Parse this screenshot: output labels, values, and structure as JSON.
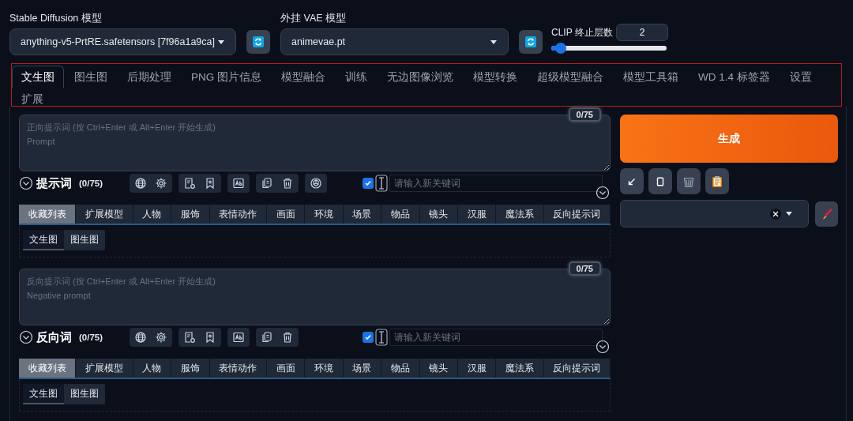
{
  "model_selectors": [
    {
      "label": "Stable Diffusion 模型",
      "value": "anything-v5-PrtRE.safetensors [7f96a1a9ca]"
    },
    {
      "label": "外挂 VAE 模型",
      "value": "animevae.pt"
    }
  ],
  "clip_skip": {
    "label": "CLIP 终止层数",
    "value": "2",
    "level": 0.08
  },
  "tabs": [
    {
      "label": "文生图",
      "selected": true
    },
    {
      "label": "图生图",
      "selected": false
    },
    {
      "label": "后期处理",
      "selected": false
    },
    {
      "label": "PNG 图片信息",
      "selected": false
    },
    {
      "label": "模型融合",
      "selected": false
    },
    {
      "label": "训练",
      "selected": false
    },
    {
      "label": "无边图像浏览",
      "selected": false
    },
    {
      "label": "模型转换",
      "selected": false
    },
    {
      "label": "超级模型融合",
      "selected": false
    },
    {
      "label": "模型工具箱",
      "selected": false
    },
    {
      "label": "WD 1.4 标签器",
      "selected": false
    },
    {
      "label": "设置",
      "selected": false
    },
    {
      "label": "扩展",
      "selected": false
    }
  ],
  "prompts": [
    {
      "counter": "0/75",
      "placeholder": "正向提示词 (按 Ctrl+Enter 或 Alt+Enter 开始生成)\nPrompt",
      "title": "提示词",
      "count": "(0/75)",
      "assistant_button": true,
      "checked": true,
      "keyword_placeholder": "请输入新关键词",
      "categories": [
        {
          "label": "收藏列表",
          "selected": true
        },
        {
          "label": "扩展模型",
          "selected": false
        },
        {
          "label": "人物",
          "selected": false
        },
        {
          "label": "服饰",
          "selected": false
        },
        {
          "label": "表情动作",
          "selected": false
        },
        {
          "label": "画面",
          "selected": false
        },
        {
          "label": "环境",
          "selected": false
        },
        {
          "label": "场景",
          "selected": false
        },
        {
          "label": "物品",
          "selected": false
        },
        {
          "label": "镜头",
          "selected": false
        },
        {
          "label": "汉服",
          "selected": false
        },
        {
          "label": "魔法系",
          "selected": false
        },
        {
          "label": "反向提示词",
          "selected": false
        }
      ],
      "subtabs": [
        {
          "label": "文生图",
          "selected": true
        },
        {
          "label": "图生图",
          "selected": false
        }
      ]
    },
    {
      "counter": "0/75",
      "placeholder": "反向提示词 (按 Ctrl+Enter 或 Alt+Enter 开始生成)\nNegative prompt",
      "title": "反向词",
      "count": "(0/75)",
      "assistant_button": false,
      "checked": true,
      "keyword_placeholder": "请输入新关键词",
      "categories": [
        {
          "label": "收藏列表",
          "selected": true
        },
        {
          "label": "扩展模型",
          "selected": false
        },
        {
          "label": "人物",
          "selected": false
        },
        {
          "label": "服饰",
          "selected": false
        },
        {
          "label": "表情动作",
          "selected": false
        },
        {
          "label": "画面",
          "selected": false
        },
        {
          "label": "环境",
          "selected": false
        },
        {
          "label": "场景",
          "selected": false
        },
        {
          "label": "物品",
          "selected": false
        },
        {
          "label": "镜头",
          "selected": false
        },
        {
          "label": "汉服",
          "selected": false
        },
        {
          "label": "魔法系",
          "selected": false
        },
        {
          "label": "反向提示词",
          "selected": false
        }
      ],
      "subtabs": [
        {
          "label": "文生图",
          "selected": true
        },
        {
          "label": "图生图",
          "selected": false
        }
      ]
    }
  ],
  "generate_label": "生成"
}
